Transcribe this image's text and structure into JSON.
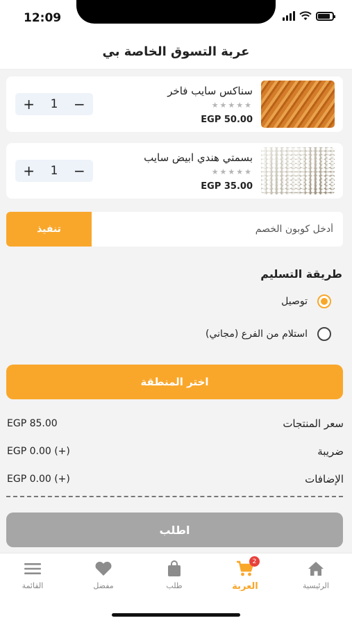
{
  "status_bar": {
    "time": "12:09",
    "icons": [
      "signal-icon",
      "wifi-icon",
      "battery-icon"
    ]
  },
  "header": {
    "title": "عربة التسوق الخاصة بي"
  },
  "cart_items": [
    {
      "name": "سناكس سايب فاخر",
      "price": "EGP 50.00",
      "quantity": "1",
      "rating": 0,
      "image": "pasta-image"
    },
    {
      "name": "بسمتي هندي ابيض سايب",
      "price": "EGP 35.00",
      "quantity": "1",
      "rating": 0,
      "image": "rice-image"
    }
  ],
  "stepper": {
    "plus": "+",
    "minus": "−"
  },
  "coupon": {
    "placeholder": "أدخل كوبون الخصم",
    "apply_label": "تنفيذ"
  },
  "delivery": {
    "title": "طريقة التسليم",
    "options": [
      {
        "label": "توصيل",
        "selected": true
      },
      {
        "label": "استلام من الفرع  (مجاني)",
        "selected": false
      }
    ]
  },
  "area_button": {
    "label": "اختر المنطقة"
  },
  "summary": {
    "rows": [
      {
        "label": "سعر المنتجات",
        "value": "EGP 85.00"
      },
      {
        "label": "ضريبة",
        "value": "EGP 0.00 (+)"
      },
      {
        "label": "الإضافات",
        "value": "EGP 0.00 (+)"
      }
    ]
  },
  "order_button": {
    "label": "اطلب"
  },
  "tabs": [
    {
      "label": "الرئيسية",
      "icon": "home-icon",
      "active": false
    },
    {
      "label": "العربة",
      "icon": "cart-icon",
      "active": true,
      "badge": "2"
    },
    {
      "label": "طلب",
      "icon": "bag-icon",
      "active": false
    },
    {
      "label": "مفضل",
      "icon": "heart-icon",
      "active": false
    },
    {
      "label": "القائمة",
      "icon": "menu-icon",
      "active": false
    }
  ],
  "colors": {
    "accent": "#f9a72b",
    "disabled": "#a6a6a6",
    "badge": "#e8413b",
    "stepper_bg": "#eef3fa"
  }
}
